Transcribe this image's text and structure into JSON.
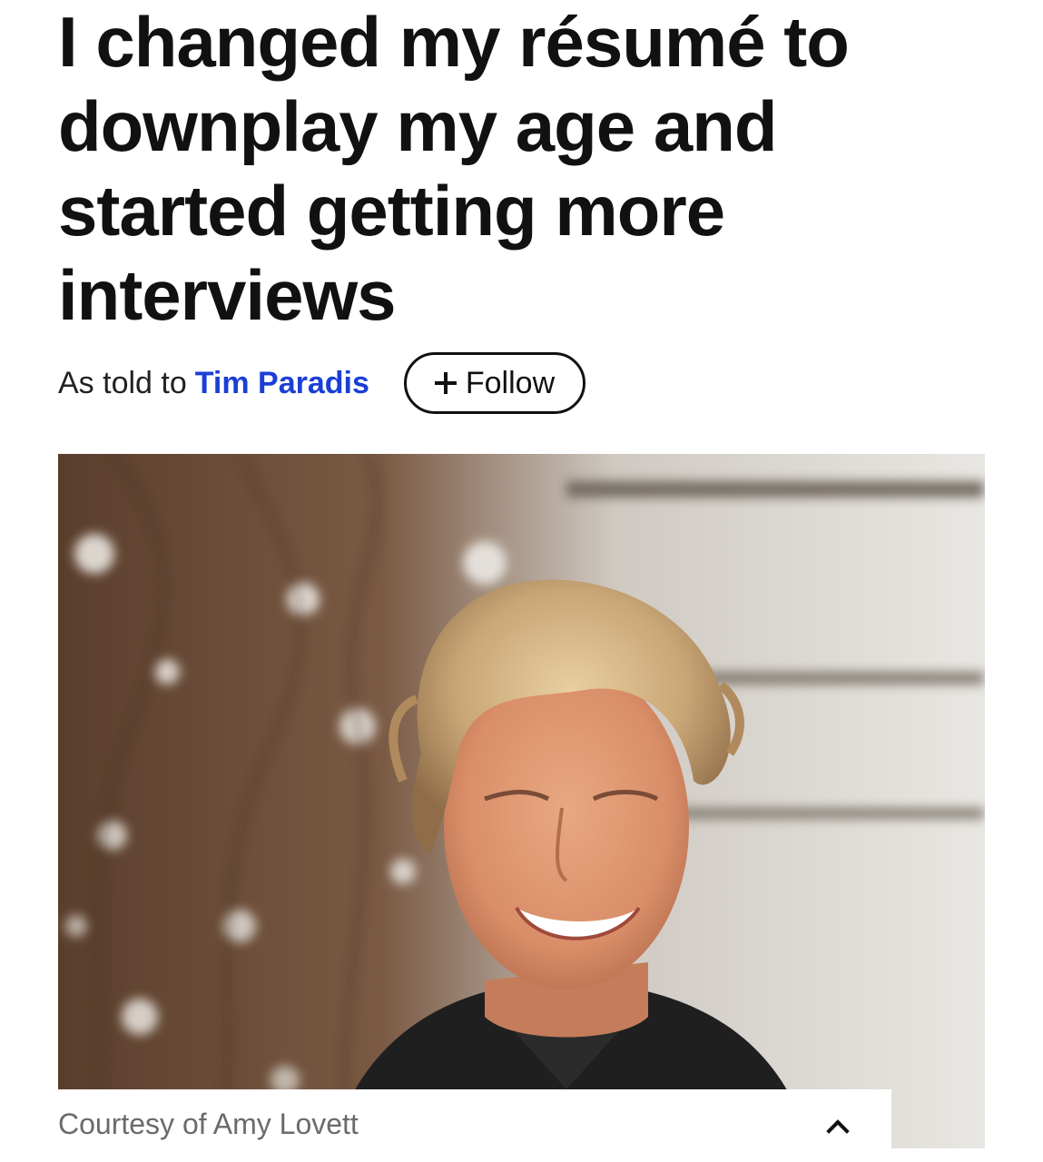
{
  "article": {
    "headline_lines": [
      "I changed my résumé to",
      "downplay my age and",
      "started getting more",
      "interviews"
    ],
    "byline": {
      "prefix": "As told to",
      "author": "Tim Paradis",
      "follow_label": "Follow",
      "follow_icon": "plus-icon",
      "author_link_color": "#1a3fd6"
    },
    "hero_image": {
      "caption": "Courtesy of Amy Lovett",
      "caption_toggle_icon": "chevron-up-icon"
    }
  }
}
